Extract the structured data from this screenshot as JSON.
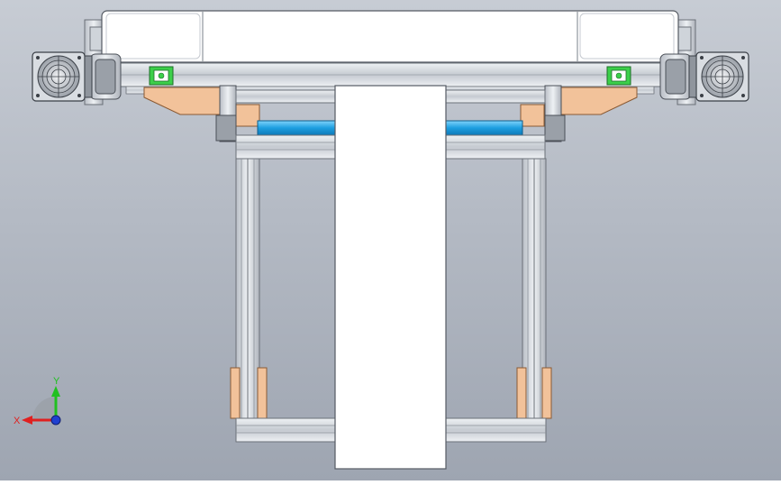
{
  "viewport": {
    "background_top": "#c7ccd4",
    "background_bottom": "#9ea5b1"
  },
  "colors": {
    "frame_metal": "#dfe3e8",
    "frame_edge": "#6b7078",
    "cover_white": "#ffffff",
    "bracket_orange": "#f2c29a",
    "shaft_blue": "#29a8e6",
    "rail_green": "#3ccf4a",
    "axis_x": "#e02020",
    "axis_y": "#20c020",
    "axis_z": "#2040d0"
  },
  "triad": {
    "x_label": "X",
    "y_label": "Y"
  }
}
